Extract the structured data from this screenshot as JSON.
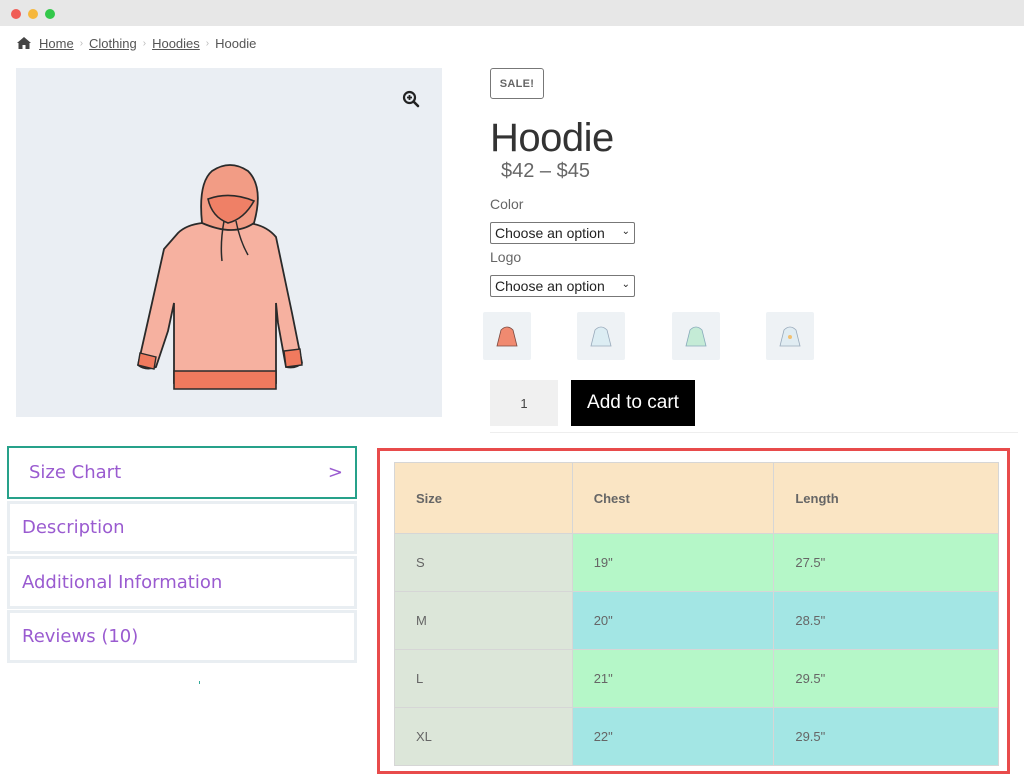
{
  "window": {
    "controls": [
      "close",
      "minimize",
      "maximize"
    ]
  },
  "breadcrumb": {
    "icon": "home-icon",
    "items": [
      {
        "label": "Home",
        "link": true
      },
      {
        "label": "Clothing",
        "link": true
      },
      {
        "label": "Hoodies",
        "link": true
      },
      {
        "label": "Hoodie",
        "link": false
      }
    ],
    "separator": "›"
  },
  "gallery": {
    "zoom_icon": "zoom-in-icon",
    "image": "pink-hoodie-illustration"
  },
  "product": {
    "badge": "SALE!",
    "title": "Hoodie",
    "price": "$42 – $45",
    "attributes": [
      {
        "label": "Color",
        "selected": "Choose an option"
      },
      {
        "label": "Logo",
        "selected": "Choose an option"
      }
    ],
    "swatches": [
      {
        "name": "Pink hoodie",
        "color": "#f08a70"
      },
      {
        "name": "Blue hoodie",
        "color": "#cfe6ee"
      },
      {
        "name": "Green hoodie",
        "color": "#bfe9d3"
      },
      {
        "name": "Blue hoodie with logo",
        "color": "#d6e6ef"
      }
    ],
    "quantity": "1",
    "add_to_cart": "Add to cart"
  },
  "tabs": {
    "items": [
      {
        "label": "Size Chart",
        "active": true,
        "chevron": ">"
      },
      {
        "label": "Description",
        "active": false
      },
      {
        "label": "Additional Information",
        "active": false
      },
      {
        "label": "Reviews (10)",
        "active": false
      }
    ]
  },
  "size_chart": {
    "headers": [
      "Size",
      "Chest",
      "Length"
    ],
    "rows": [
      {
        "size": "S",
        "chest": "19\"",
        "length": "27.5\""
      },
      {
        "size": "M",
        "chest": "20\"",
        "length": "28.5\""
      },
      {
        "size": "L",
        "chest": "21\"",
        "length": "29.5\""
      },
      {
        "size": "XL",
        "chest": "22\"",
        "length": "29.5\""
      }
    ]
  },
  "colors": {
    "active_tab_border": "#26a18a",
    "tab_text": "#9a5bd0",
    "highlight_frame": "#e84b4b",
    "header_bg": "#fae5c4",
    "size_col_bg": "#dce6d9",
    "row_green": "#b5f7c8",
    "row_cyan": "#a3e6e4"
  }
}
